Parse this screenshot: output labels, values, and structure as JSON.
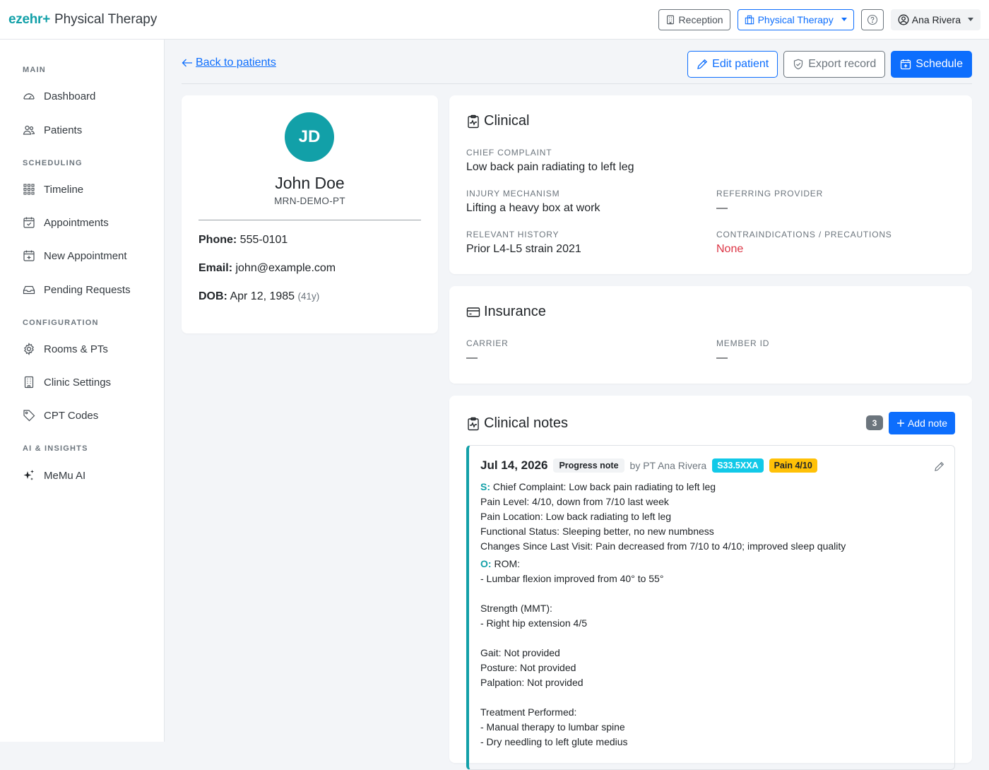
{
  "brand": {
    "logo": "ezehr+",
    "name": "Physical Therapy",
    "accent": "#12a0a8"
  },
  "topbar": {
    "reception": "Reception",
    "department": "Physical Therapy",
    "help_icon": "question-circle-icon",
    "user": "Ana Rivera"
  },
  "sidebar": {
    "main_label": "MAIN",
    "dashboard": "Dashboard",
    "patients": "Patients",
    "scheduling_label": "SCHEDULING",
    "timeline": "Timeline",
    "appointments": "Appointments",
    "new_appointment": "New Appointment",
    "pending_requests": "Pending Requests",
    "configuration_label": "CONFIGURATION",
    "rooms": "Rooms & PTs",
    "clinic_settings": "Clinic Settings",
    "cpt_codes": "CPT Codes",
    "ai_label": "AI & INSIGHTS",
    "memu": "MeMu AI"
  },
  "toolbar": {
    "back": "Back to patients",
    "edit": "Edit patient",
    "export": "Export record",
    "schedule": "Schedule"
  },
  "patient": {
    "initials": "JD",
    "name": "John Doe",
    "mrn": "MRN-DEMO-PT",
    "phone_label": "Phone:",
    "phone": "555-0101",
    "email_label": "Email:",
    "email": "john@example.com",
    "dob_label": "DOB:",
    "dob": "Apr 12, 1985",
    "age": "(41y)"
  },
  "clinical": {
    "title": "Clinical",
    "chief_complaint_label": "CHIEF COMPLAINT",
    "chief_complaint": "Low back pain radiating to left leg",
    "injury_mechanism_label": "INJURY MECHANISM",
    "injury_mechanism": "Lifting a heavy box at work",
    "referring_provider_label": "REFERRING PROVIDER",
    "referring_provider": "—",
    "relevant_history_label": "RELEVANT HISTORY",
    "relevant_history": "Prior L4-L5 strain 2021",
    "contraindications_label": "CONTRAINDICATIONS / PRECAUTIONS",
    "contraindications": "None",
    "contraindications_color": "#dc3545"
  },
  "insurance": {
    "title": "Insurance",
    "carrier_label": "CARRIER",
    "carrier": "—",
    "member_id_label": "MEMBER ID",
    "member_id": "—"
  },
  "notes": {
    "title": "Clinical notes",
    "count": "3",
    "add_label": "Add note",
    "note": {
      "date": "Jul 14, 2026",
      "type": "Progress note",
      "author": "by PT Ana Rivera",
      "code": "S33.5XXA",
      "pain": "Pain 4/10",
      "s_label": "S:",
      "s_lines": [
        "Chief Complaint: Low back pain radiating to left leg",
        "Pain Level: 4/10, down from 7/10 last week",
        "Pain Location: Low back radiating to left leg",
        "Functional Status: Sleeping better, no new numbness",
        "Changes Since Last Visit: Pain decreased from 7/10 to 4/10; improved sleep quality"
      ],
      "o_label": "O:",
      "o_first": "ROM:",
      "o_lines": [
        "- Lumbar flexion improved from 40° to 55°",
        "",
        "Strength (MMT):",
        "- Right hip extension 4/5",
        "",
        "Gait: Not provided",
        "Posture: Not provided",
        "Palpation: Not provided",
        "",
        "Treatment Performed:",
        "- Manual therapy to lumbar spine",
        "- Dry needling to left glute medius"
      ]
    }
  }
}
